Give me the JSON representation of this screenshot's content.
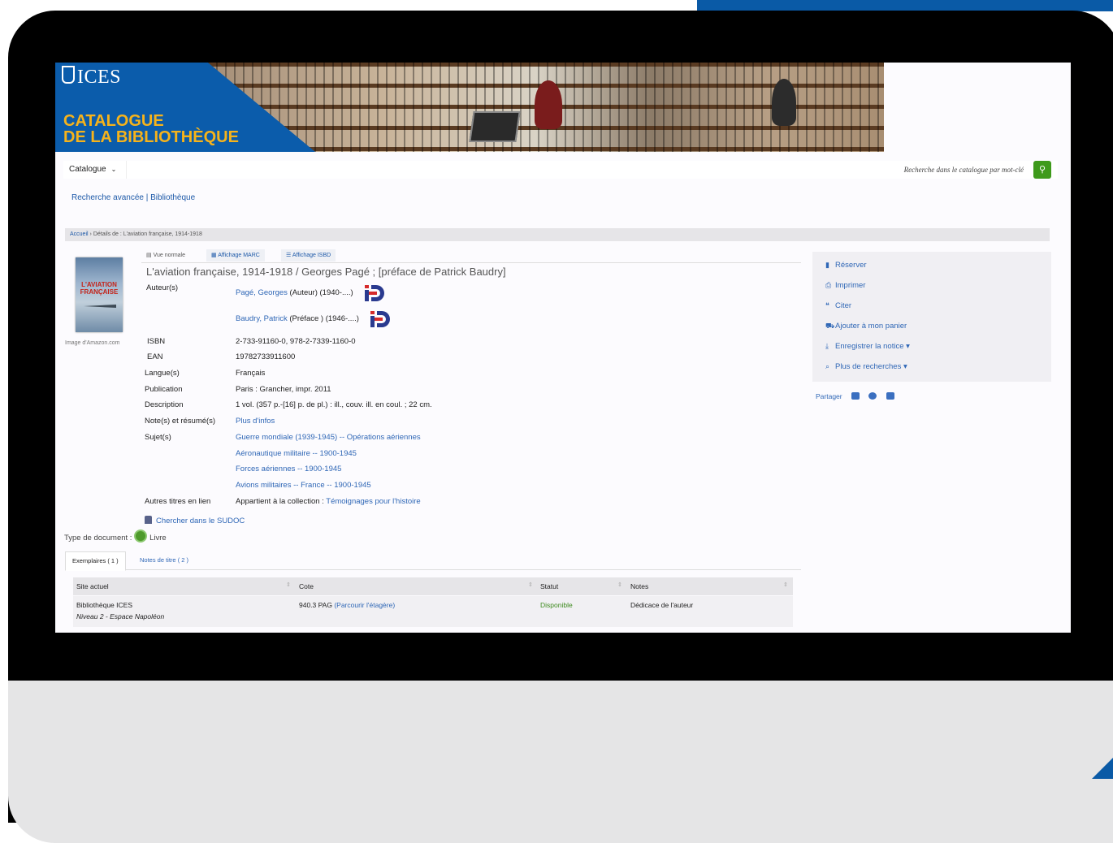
{
  "brand": {
    "logo_text": "ICES",
    "title_line1": "CATALOGUE",
    "title_line2": "DE LA BIBLIOTHÈQUE"
  },
  "search": {
    "scope_label": "Catalogue",
    "placeholder": "Recherche dans le catalogue par mot-clé"
  },
  "nav": {
    "advanced_search": "Recherche avancée",
    "separator": "|",
    "library": "Bibliothèque"
  },
  "breadcrumb": {
    "home": "Accueil",
    "current": "Détails de : L'aviation française, 1914-1918"
  },
  "cover": {
    "line1": "L'AVIATION",
    "line2": "FRANÇAISE",
    "caption": "Image d'Amazon.com"
  },
  "view_tabs": [
    {
      "label": "Vue normale"
    },
    {
      "label": "Affichage MARC"
    },
    {
      "label": "Affichage ISBD"
    }
  ],
  "record": {
    "title": "L'aviation française, 1914-1918 / Georges Pagé ; [préface de Patrick Baudry]",
    "fields": {
      "authors_label": "Auteur(s)",
      "author1_name": "Pagé, Georges",
      "author1_role": "(Auteur) (1940-....)",
      "author2_name": "Baudry, Patrick",
      "author2_role": "(Préface ) (1946-....)",
      "isbn_label": "ISBN",
      "isbn": "2-733-91160-0, 978-2-7339-1160-0",
      "ean_label": "EAN",
      "ean": "19782733911600",
      "language_label": "Langue(s)",
      "language": "Français",
      "publication_label": "Publication",
      "publication": "Paris : Grancher, impr. 2011",
      "description_label": "Description",
      "description": "1 vol. (357 p.-[16] p. de pl.) : ill., couv. ill. en coul. ; 22 cm.",
      "notes_label": "Note(s) et résumé(s)",
      "notes_link": "Plus d'infos",
      "subjects_label": "Sujet(s)",
      "subjects": [
        "Guerre mondiale (1939-1945) -- Opérations aériennes",
        "Aéronautique militaire -- 1900-1945",
        "Forces aériennes -- 1900-1945",
        "Avions militaires -- France -- 1900-1945"
      ],
      "other_titles_label": "Autres titres en lien",
      "collection_prefix": "Appartient à la collection :",
      "collection_link": "Témoignages pour l'histoire"
    },
    "sudoc_link": "Chercher dans le SUDOC",
    "doc_type_label": "Type de document :",
    "doc_type": "Livre"
  },
  "holdings_tabs": [
    {
      "label": "Exemplaires ( 1 )"
    },
    {
      "label": "Notes de titre ( 2 )"
    }
  ],
  "holdings_table": {
    "headers": [
      "Site actuel",
      "Cote",
      "Statut",
      "Notes"
    ],
    "rows": [
      {
        "site": "Bibliothèque ICES",
        "site_detail": "Niveau 2 - Espace Napoléon",
        "cote": "940.3 PAG",
        "cote_link": "(Parcourir l'étagère)",
        "status": "Disponible",
        "notes": "Dédicace de l'auteur"
      }
    ]
  },
  "actions": [
    {
      "label": "Réserver",
      "icon": "bookmark-icon"
    },
    {
      "label": "Imprimer",
      "icon": "printer-icon"
    },
    {
      "label": "Citer",
      "icon": "quote-icon"
    },
    {
      "label": "Ajouter à mon panier",
      "icon": "cart-icon"
    },
    {
      "label": "Enregistrer la notice",
      "icon": "download-icon"
    },
    {
      "label": "Plus de recherches",
      "icon": "search-icon"
    }
  ],
  "share": {
    "label": "Partager"
  },
  "colors": {
    "brand_blue": "#0b5cab",
    "brand_gold": "#f6b31b",
    "link_blue": "#2f67b6",
    "search_green": "#3e9a1b",
    "available_green": "#3d8a1e"
  }
}
